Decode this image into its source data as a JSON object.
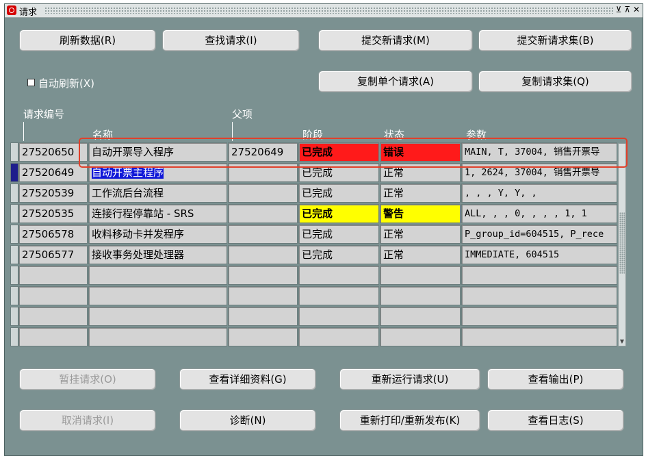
{
  "window": {
    "title": "请求",
    "controls": "⊻ ⊼ ✕"
  },
  "buttons": {
    "refresh": "刷新数据(R)",
    "find": "查找请求(I)",
    "submit_new": "提交新请求(M)",
    "submit_set": "提交新请求集(B)",
    "copy_single": "复制单个请求(A)",
    "copy_set": "复制请求集(Q)",
    "hold": "暂挂请求(O)",
    "view_details": "查看详细资料(G)",
    "rerun": "重新运行请求(U)",
    "view_output": "查看输出(P)",
    "cancel": "取消请求(I)",
    "diagnose": "诊断(N)",
    "reprint": "重新打印/重新发布(K)",
    "view_log": "查看日志(S)"
  },
  "auto_refresh": {
    "label": "自动刷新(X)",
    "checked": false
  },
  "headers": {
    "request_id": "请求编号",
    "parent": "父项",
    "name": "名称",
    "phase": "阶段",
    "status": "状态",
    "parameters": "参数"
  },
  "rows": [
    {
      "id": "27520650",
      "name": "自动开票导入程序",
      "parent": "27520649",
      "phase": "已完成",
      "status": "错误",
      "params": "MAIN, T, 37004, 销售开票导"
    },
    {
      "id": "27520649",
      "name": "自动开票主程序",
      "parent": "",
      "phase": "已完成",
      "status": "正常",
      "params": "1, 2624, 37004, 销售开票导"
    },
    {
      "id": "27520539",
      "name": "工作流后台流程",
      "parent": "",
      "phase": "已完成",
      "status": "正常",
      "params": ", , , Y, Y, ,"
    },
    {
      "id": "27520535",
      "name": "连接行程停靠站 - SRS",
      "parent": "",
      "phase": "已完成",
      "status": "警告",
      "params": "ALL, , , 0, , , , 1, 1"
    },
    {
      "id": "27506578",
      "name": "收料移动卡并发程序",
      "parent": "",
      "phase": "已完成",
      "status": "正常",
      "params": "P_group_id=604515, P_rece"
    },
    {
      "id": "27506577",
      "name": "接收事务处理处理器",
      "parent": "",
      "phase": "已完成",
      "status": "正常",
      "params": "IMMEDIATE, 604515"
    }
  ],
  "colors": {
    "error": "#ff1a1a",
    "warning": "#ffff00",
    "window_bg": "#7b9191",
    "selection": "#1018d8"
  }
}
